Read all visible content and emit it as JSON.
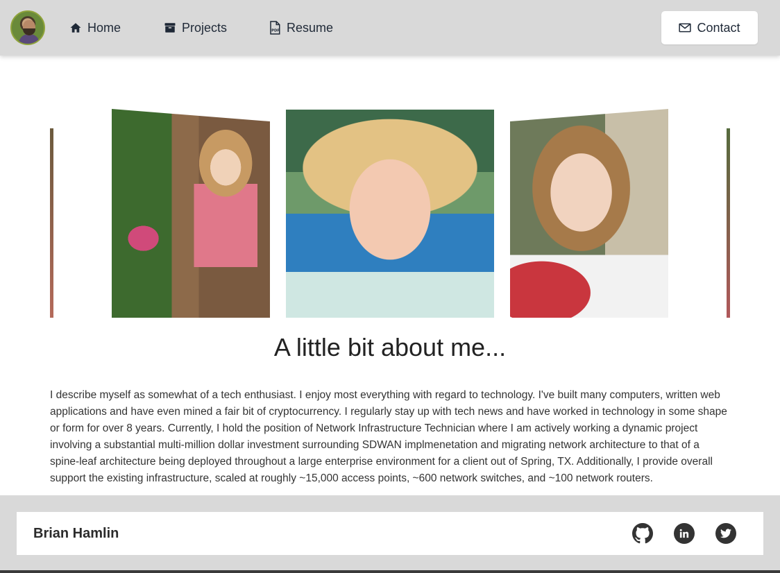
{
  "nav": {
    "home_label": "Home",
    "projects_label": "Projects",
    "resume_label": "Resume",
    "contact_label": "Contact"
  },
  "about": {
    "title": "A little bit about me...",
    "text": "I describe myself as somewhat of a tech enthusiast. I enjoy most everything with regard to technology. I've built many computers, written web applications and have even mined a fair bit of cryptocurrency. I regularly stay up with tech news and have worked in technology in some shape or form for over 8 years. Currently, I hold the position of Network Infrastructure Technician where I am actively working a dynamic project involving a substantial multi-million dollar investment surrounding SDWAN implmenetation and migrating network architecture to that of a spine-leaf architecture being deployed throughout a large enterprise environment for a client out of Spring, TX. Additionally, I provide overall support the existing infrastructure, scaled at roughly ~15,000 access points, ~600 network switches, and ~100 network routers."
  },
  "footer": {
    "name": "Brian Hamlin"
  },
  "icons": {
    "home": "home-icon",
    "projects": "archive-icon",
    "resume": "pdf-icon",
    "contact": "mail-icon",
    "github": "github-icon",
    "linkedin": "linkedin-icon",
    "twitter": "twitter-icon"
  },
  "colors": {
    "navbar_bg": "#d9d9d9",
    "footer_bg": "#d9d9d9",
    "text": "#1f2937"
  }
}
